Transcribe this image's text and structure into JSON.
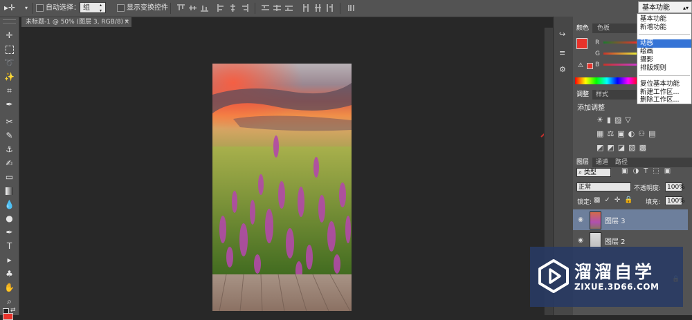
{
  "options_bar": {
    "auto_select_label": "自动选择：",
    "auto_select_value": "组",
    "show_transform_label": "显示变换控件"
  },
  "document_tab": {
    "title": "未标题-1 @ 50% (图层 3, RGB/8) *",
    "close": "×"
  },
  "workspace": {
    "current": "基本功能",
    "menu": [
      "基本功能",
      "新增功能",
      "动感",
      "绘画",
      "摄影",
      "排版规则",
      "复位基本功能",
      "新建工作区...",
      "删除工作区..."
    ],
    "highlighted": "动感"
  },
  "color_panel": {
    "tabs": [
      "颜色",
      "色板"
    ],
    "channels": [
      "R",
      "G",
      "B"
    ],
    "foreground": "#e8322a"
  },
  "adjustments_panel": {
    "tabs": [
      "调整",
      "样式"
    ],
    "title": "添加调整"
  },
  "layers_panel": {
    "tabs": [
      "图层",
      "通道",
      "路径"
    ],
    "filter_kind": "类型",
    "blend_mode": "正常",
    "opacity_label": "不透明度:",
    "opacity_value": "100%",
    "lock_label": "锁定:",
    "fill_label": "填充:",
    "fill_value": "100%",
    "layers": [
      {
        "name": "图层 3",
        "selected": true
      },
      {
        "name": "图层 2",
        "selected": false
      }
    ]
  },
  "watermark": {
    "brand": "溜溜自学",
    "url": "ZIXUE.3D66.COM"
  },
  "colors": {
    "accent_red": "#c9302c",
    "menu_highlight": "#3574d6",
    "selected_layer": "#6d7f9c"
  }
}
